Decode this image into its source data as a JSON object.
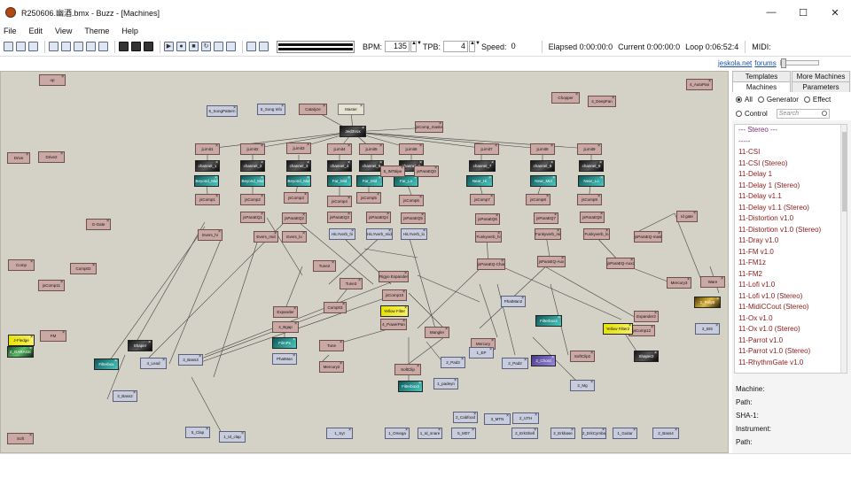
{
  "window": {
    "title": "R250606.幽酒.bmx - Buzz - [Machines]",
    "buttons": {
      "minimize": "—",
      "maximize": "☐",
      "close": "✕"
    }
  },
  "menu": [
    "File",
    "Edit",
    "View",
    "Theme",
    "Help"
  ],
  "toolbar": {
    "bpm_label": "BPM:",
    "bpm_value": "135",
    "tpb_label": "TPB:",
    "tpb_value": "4",
    "speed_label": "Speed:",
    "speed_value": "0",
    "elapsed": "Elapsed 0:00:00:0",
    "current": "Current 0:00:00:0",
    "loop": "Loop 0:06:52:4",
    "midi_label": "MIDI:"
  },
  "links": {
    "site": "jeskola.net",
    "forums": "forums"
  },
  "panel": {
    "tabs_top": [
      "Templates",
      "More Machines"
    ],
    "tabs_bottom": [
      "Machines",
      "Parameters"
    ],
    "radios": [
      "All",
      "Generator",
      "Effect",
      "Control"
    ],
    "search_placeholder": "Search",
    "machine_list": [
      "--- Stereo ---",
      "-----",
      "11-CSI",
      "11-CSI (Stereo)",
      "11-Delay 1",
      "11-Delay 1 (Stereo)",
      "11-Delay v1.1",
      "11-Delay v1.1 (Stereo)",
      "11-Distortion v1.0",
      "11-Distortion v1.0 (Stereo)",
      "11-Dray v1.0",
      "11-FM v1.0",
      "11-FM1z",
      "11-FM2",
      "11-Lofi v1.0",
      "11-Lofi v1.0 (Stereo)",
      "11-MidiCCout (Stereo)",
      "11-Ox v1.0",
      "11-Ox v1.0 (Stereo)",
      "11-Parrot v1.0",
      "11-Parrot v1.0 (Stereo)",
      "11-RhythmGate v1.0"
    ],
    "info": [
      "Machine:",
      "Path:",
      "SHA-1:",
      "Instrument:",
      "Path:"
    ]
  },
  "machines": [
    {
      "name": "op",
      "kind": "eff"
    },
    {
      "name": "Drive",
      "kind": "eff"
    },
    {
      "name": "Drive2",
      "kind": "eff"
    },
    {
      "name": "Comp",
      "kind": "eff"
    },
    {
      "name": "Comp02",
      "kind": "eff"
    },
    {
      "name": "jsComp11",
      "kind": "eff"
    },
    {
      "name": "FM",
      "kind": "eff"
    },
    {
      "name": "5_SongPattern",
      "kind": "gen"
    },
    {
      "name": "5_Song Info",
      "kind": "gen"
    },
    {
      "name": "Catalyze",
      "kind": "eff"
    },
    {
      "name": "Master",
      "kind": "ctl"
    },
    {
      "name": "Jed3Vox",
      "kind": "img dark"
    },
    {
      "name": "jsComp_master",
      "kind": "eff"
    },
    {
      "name": "Chopper",
      "kind": "eff"
    },
    {
      "name": "4_DeepFan",
      "kind": "eff"
    },
    {
      "name": "4_AutoPan",
      "kind": "eff"
    },
    {
      "name": "jLimit1",
      "kind": "eff"
    },
    {
      "name": "jLimit2",
      "kind": "eff"
    },
    {
      "name": "jLimit3",
      "kind": "eff"
    },
    {
      "name": "jLimit4",
      "kind": "eff"
    },
    {
      "name": "jLimit5",
      "kind": "eff"
    },
    {
      "name": "jLimit6",
      "kind": "eff"
    },
    {
      "name": "jLimit7",
      "kind": "eff"
    },
    {
      "name": "jLimit8",
      "kind": "eff"
    },
    {
      "name": "jLimit9",
      "kind": "eff"
    },
    {
      "name": "channel_1",
      "kind": "img dark"
    },
    {
      "name": "channel_2",
      "kind": "img dark"
    },
    {
      "name": "channel_3",
      "kind": "img dark"
    },
    {
      "name": "channel_4",
      "kind": "img dark"
    },
    {
      "name": "channel_5",
      "kind": "img dark"
    },
    {
      "name": "channel_6",
      "kind": "img dark"
    },
    {
      "name": "channel_7",
      "kind": "img dark"
    },
    {
      "name": "channel_8",
      "kind": "img dark"
    },
    {
      "name": "channel_9",
      "kind": "img dark"
    },
    {
      "name": "Beyond_Mid",
      "kind": "img teal"
    },
    {
      "name": "Beyond_Mid",
      "kind": "img teal"
    },
    {
      "name": "Beyond_Mid",
      "kind": "img teal"
    },
    {
      "name": "Far_Mid",
      "kind": "img teal"
    },
    {
      "name": "Far_Mid",
      "kind": "img teal"
    },
    {
      "name": "Far_Lo",
      "kind": "img teal"
    },
    {
      "name": "Near_Hi",
      "kind": "img teal"
    },
    {
      "name": "Near_Mid",
      "kind": "img teal"
    },
    {
      "name": "Near_Lo",
      "kind": "img teal"
    },
    {
      "name": "jsComp1",
      "kind": "eff"
    },
    {
      "name": "jsComp2",
      "kind": "eff"
    },
    {
      "name": "jsComp3",
      "kind": "eff"
    },
    {
      "name": "jsComp4",
      "kind": "eff"
    },
    {
      "name": "jsComp5",
      "kind": "eff"
    },
    {
      "name": "jsComp6",
      "kind": "eff"
    },
    {
      "name": "jsComp7",
      "kind": "eff"
    },
    {
      "name": "jsComp8",
      "kind": "eff"
    },
    {
      "name": "jsComp9",
      "kind": "eff"
    },
    {
      "name": "jsParaEQ1",
      "kind": "eff"
    },
    {
      "name": "jsParaEQ2",
      "kind": "eff"
    },
    {
      "name": "jsParaEQ3",
      "kind": "eff"
    },
    {
      "name": "jsParaEQ4",
      "kind": "eff"
    },
    {
      "name": "jsParaEQ5",
      "kind": "eff"
    },
    {
      "name": "jsParaEQ6",
      "kind": "eff"
    },
    {
      "name": "jsParaEQ7",
      "kind": "eff"
    },
    {
      "name": "jsParaEQ8",
      "kind": "eff"
    },
    {
      "name": "G-Gate",
      "kind": "eff"
    },
    {
      "name": "Id gate",
      "kind": "eff"
    },
    {
      "name": "Evers_hi",
      "kind": "eff"
    },
    {
      "name": "Evers_mid",
      "kind": "eff"
    },
    {
      "name": "Evers_lo",
      "kind": "eff"
    },
    {
      "name": "HiLYverb_hi",
      "kind": "gen"
    },
    {
      "name": "HiLYverb_mid",
      "kind": "gen"
    },
    {
      "name": "HiLYverb_lo",
      "kind": "gen"
    },
    {
      "name": "Funkyverb_hi",
      "kind": "eff"
    },
    {
      "name": "Funkyverb_mid",
      "kind": "eff"
    },
    {
      "name": "Funkyverb_lo",
      "kind": "eff"
    },
    {
      "name": "jsParaEQ-master",
      "kind": "eff"
    },
    {
      "name": "jsParaEQ-Chan",
      "kind": "eff"
    },
    {
      "name": "jsParaEQ-Aux",
      "kind": "eff"
    },
    {
      "name": "jsParaEQ-Aux2",
      "kind": "eff"
    },
    {
      "name": "Ware",
      "kind": "eff"
    },
    {
      "name": "Tune2",
      "kind": "eff"
    },
    {
      "name": "Tune3",
      "kind": "eff"
    },
    {
      "name": "Expander",
      "kind": "eff"
    },
    {
      "name": "Expander2",
      "kind": "eff"
    },
    {
      "name": "Mercury2",
      "kind": "eff"
    },
    {
      "name": "Mercury3",
      "kind": "eff"
    },
    {
      "name": "Rigyo Expander",
      "kind": "eff"
    },
    {
      "name": "jsComp10",
      "kind": "eff"
    },
    {
      "name": "jsComp12",
      "kind": "eff"
    },
    {
      "name": "Comp03",
      "kind": "eff"
    },
    {
      "name": "Yellow Filter",
      "kind": "img yellow"
    },
    {
      "name": "Yellow Filter2",
      "kind": "img yellow"
    },
    {
      "name": "4_PowerPan",
      "kind": "eff"
    },
    {
      "name": "4_Bgap",
      "kind": "eff"
    },
    {
      "name": "Mangler",
      "kind": "eff"
    },
    {
      "name": "Tune",
      "kind": "eff"
    },
    {
      "name": "Shaper2",
      "kind": "img dark"
    },
    {
      "name": "Shaper",
      "kind": "img dark"
    },
    {
      "name": "SoftClip",
      "kind": "eff"
    },
    {
      "name": "SoftClip2",
      "kind": "eff"
    },
    {
      "name": "Mercury",
      "kind": "eff"
    },
    {
      "name": "FilmPs",
      "kind": "img teal"
    },
    {
      "name": "PhatMan",
      "kind": "gen"
    },
    {
      "name": "PhatMan2",
      "kind": "gen"
    },
    {
      "name": "Filterbox",
      "kind": "img teal"
    },
    {
      "name": "Filterbox2",
      "kind": "img teal"
    },
    {
      "name": "Filterbox3",
      "kind": "img teal"
    },
    {
      "name": "1_padeyn",
      "kind": "gen"
    },
    {
      "name": "1_EP",
      "kind": "gen"
    },
    {
      "name": "2_Pad2",
      "kind": "gen"
    },
    {
      "name": "2_Pad3",
      "kind": "gen"
    },
    {
      "name": "2_Chord",
      "kind": "img purple"
    },
    {
      "name": "2_Mg",
      "kind": "gen"
    },
    {
      "name": "3_Bass3",
      "kind": "gen"
    },
    {
      "name": "3_Bass2",
      "kind": "gen"
    },
    {
      "name": "4_Lead",
      "kind": "gen"
    },
    {
      "name": "5_Clap",
      "kind": "gen"
    },
    {
      "name": "1_Id_clap",
      "kind": "gen"
    },
    {
      "name": "1_Syt",
      "kind": "gen"
    },
    {
      "name": "1_Omega",
      "kind": "gen"
    },
    {
      "name": "1_Id_snare",
      "kind": "gen"
    },
    {
      "name": "5_M07",
      "kind": "gen"
    },
    {
      "name": "2_Cabfood",
      "kind": "gen"
    },
    {
      "name": "3_MTN",
      "kind": "gen"
    },
    {
      "name": "2_UTH",
      "kind": "gen"
    },
    {
      "name": "2_ErkShell",
      "kind": "gen"
    },
    {
      "name": "2_Erkbase",
      "kind": "gen"
    },
    {
      "name": "2_ErkCymbal",
      "kind": "gen"
    },
    {
      "name": "1_Guitar",
      "kind": "gen"
    },
    {
      "name": "2_Bass4",
      "kind": "gen"
    },
    {
      "name": "3_BIS",
      "kind": "gen"
    },
    {
      "name": "1_PolyB",
      "kind": "img gold"
    },
    {
      "name": "2_GARAGE",
      "kind": "img green"
    },
    {
      "name": "J-Fledge",
      "kind": "img yellow"
    },
    {
      "name": "Soft",
      "kind": "eff"
    },
    {
      "name": "5_IMTalpe",
      "kind": "eff"
    },
    {
      "name": "jsParaEQ0",
      "kind": "eff"
    }
  ]
}
